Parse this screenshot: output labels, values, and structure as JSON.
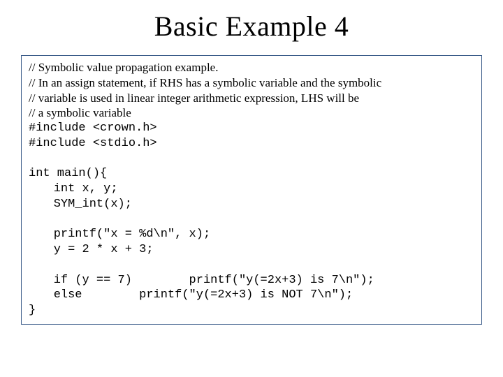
{
  "title": "Basic Example 4",
  "code": {
    "c1": "// Symbolic value propagation example.",
    "c2": "// In an assign statement, if RHS has a symbolic variable and the symbolic",
    "c3": "// variable is used in linear integer arithmetic expression, LHS will be",
    "c4": "// a symbolic variable",
    "inc1": "#include <crown.h>",
    "inc2": "#include <stdio.h>",
    "main_sig": "int main(){",
    "decl": "int x, y;",
    "syminit": "SYM_int(x);",
    "printf1": "printf(\"x = %d\\n\", x);",
    "assign": "y = 2 * x + 3;",
    "if_line": "if (y == 7)        printf(\"y(=2x+3) is 7\\n\");",
    "else_line": "else        printf(\"y(=2x+3) is NOT 7\\n\");",
    "close": "}"
  }
}
